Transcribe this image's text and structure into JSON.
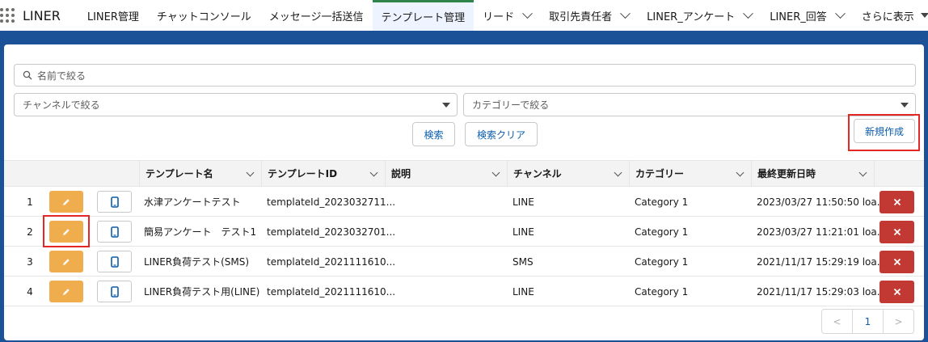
{
  "app": {
    "name": "LINER"
  },
  "nav": [
    {
      "label": "LINER管理",
      "dropdown": false,
      "active": false
    },
    {
      "label": "チャットコンソール",
      "dropdown": false,
      "active": false
    },
    {
      "label": "メッセージ一括送信",
      "dropdown": false,
      "active": false
    },
    {
      "label": "テンプレート管理",
      "dropdown": false,
      "active": true
    },
    {
      "label": "リード",
      "dropdown": true,
      "active": false
    },
    {
      "label": "取引先責任者",
      "dropdown": true,
      "active": false
    },
    {
      "label": "LINER_アンケート",
      "dropdown": true,
      "active": false
    },
    {
      "label": "LINER_回答",
      "dropdown": true,
      "active": false
    },
    {
      "label": "さらに表示",
      "dropdown": true,
      "active": false
    }
  ],
  "filters": {
    "search_placeholder": "名前で絞る",
    "channel_placeholder": "チャンネルで絞る",
    "category_placeholder": "カテゴリーで絞る"
  },
  "buttons": {
    "search": "検索",
    "clear": "検索クリア",
    "new": "新規作成"
  },
  "table": {
    "columns": [
      "テンプレート名",
      "テンプレートID",
      "説明",
      "チャンネル",
      "カテゴリー",
      "最終更新日時"
    ],
    "rows": [
      {
        "num": "1",
        "name": "水津アンケートテスト",
        "id": "templateId_2023032711...",
        "desc": "",
        "channel": "LINE",
        "category": "Category 1",
        "updated": "2023/03/27 11:50:50 loa..."
      },
      {
        "num": "2",
        "name": "簡易アンケート　テスト1",
        "id": "templateId_2023032701...",
        "desc": "",
        "channel": "LINE",
        "category": "Category 1",
        "updated": "2023/03/27 11:21:01 loa..."
      },
      {
        "num": "3",
        "name": "LINER負荷テスト(SMS)",
        "id": "templateId_2021111610...",
        "desc": "",
        "channel": "SMS",
        "category": "Category 1",
        "updated": "2021/11/17 15:29:19 loa..."
      },
      {
        "num": "4",
        "name": "LINER負荷テスト用(LINE)",
        "id": "templateId_2021111610...",
        "desc": "",
        "channel": "LINE",
        "category": "Category 1",
        "updated": "2021/11/17 15:29:03 loa..."
      }
    ]
  },
  "pagination": {
    "prev": "<",
    "current": "1",
    "next": ">"
  },
  "colors": {
    "edit": "#f0ad4e",
    "delete": "#c23934",
    "highlight": "#e32626",
    "accent": "#0b5cab"
  }
}
